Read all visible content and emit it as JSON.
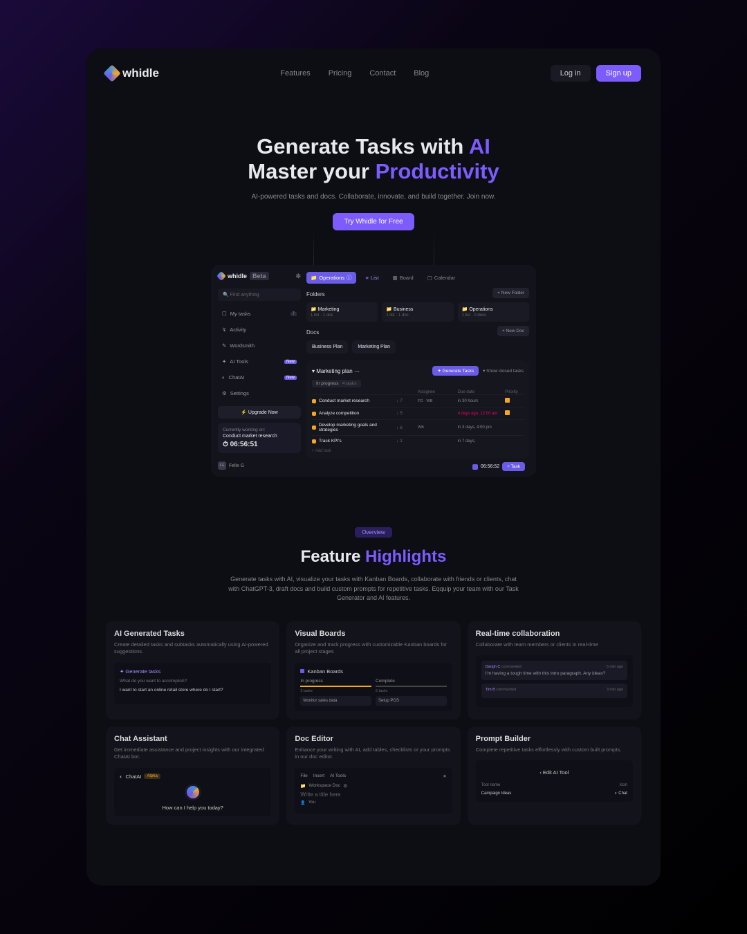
{
  "brand": "whidle",
  "nav": [
    "Features",
    "Pricing",
    "Contact",
    "Blog"
  ],
  "auth": {
    "login": "Log in",
    "signup": "Sign up"
  },
  "hero": {
    "line1a": "Generate Tasks with ",
    "line1b": "AI",
    "line2a": "Master your ",
    "line2b": "Productivity",
    "sub": "AI-powered tasks and docs. Collaborate, innovate, and build together. Join now.",
    "cta": "Try Whidle for Free"
  },
  "app": {
    "beta": "Beta",
    "search": "Find anything",
    "sidebar": [
      {
        "label": "My tasks",
        "ind": "7"
      },
      {
        "label": "Activity"
      },
      {
        "label": "Wordsmith"
      },
      {
        "label": "AI Tools",
        "tag": "New"
      },
      {
        "label": "ChatAI",
        "tag": "New"
      },
      {
        "label": "Settings"
      }
    ],
    "upgrade": "Upgrade Now",
    "working": {
      "lbl": "Currently working on:",
      "task": "Conduct market research",
      "time": "06:56:51"
    },
    "user": {
      "initials": "FG",
      "name": "Felix G"
    },
    "breadcrumb": "Operations",
    "views": [
      "List",
      "Board",
      "Calendar"
    ],
    "foldersLbl": "Folders",
    "newFolder": "+ New Folder",
    "folders": [
      {
        "name": "Marketing",
        "sub": "1 list · 1 doc"
      },
      {
        "name": "Business",
        "sub": "1 list · 1 doc"
      },
      {
        "name": "Operations",
        "sub": "1 list · 0 docs"
      }
    ],
    "docsLbl": "Docs",
    "newDoc": "+ New Doc",
    "docs": [
      "Business Plan",
      "Marketing Plan"
    ],
    "plan": {
      "title": "Marketing plan",
      "gen": "✦ Generate Tasks",
      "closed": "Show closed tasks",
      "status": "In progress",
      "count": "4 tasks",
      "cols": [
        "",
        "",
        "Assignee",
        "Due date",
        "Priority"
      ],
      "rows": [
        {
          "name": "Conduct market research",
          "ct": "↓ 7",
          "as": "FG · WB",
          "dt": "in 30 hours",
          "pr": true
        },
        {
          "name": "Analyze competition",
          "ct": "↓ 5",
          "as": "",
          "dt": "4 days ago, 12:00 am",
          "pr": true
        },
        {
          "name": "Develop marketing goals and strategies",
          "ct": "↓ 6",
          "as": "WB",
          "dt": "in 3 days, 4:00 pm",
          "pr": false
        },
        {
          "name": "Track KPI's",
          "ct": "↓ 1",
          "as": "",
          "dt": "in 7 days,",
          "pr": false
        }
      ],
      "addTask": "+ Add task",
      "timer": "06:56:52",
      "taskBtn": "+ Task"
    }
  },
  "features": {
    "chip": "Overview",
    "title1": "Feature ",
    "title2": "Highlights",
    "desc": "Generate tasks with AI, visualize your tasks with Kanban Boards, collaborate with friends or clients, chat with ChatGPT-3, draft docs and build custom prompts for repetitive tasks. Eqquip your team with our Task Generator and AI features.",
    "cards": [
      {
        "title": "AI Generated Tasks",
        "desc": "Create detailed tasks and subtasks automatically using AI-powered suggestions.",
        "demo": {
          "head": "✦ Generate tasks",
          "q": "What do you want to accomplish?",
          "a": "I want to start an online retail store where do I start?"
        }
      },
      {
        "title": "Visual Boards",
        "desc": "Organize and track progress with customizable Kanban boards for all project stages",
        "demo": {
          "head": "Kanban Boards",
          "col1": "In progress",
          "col1s": "3 tasks",
          "col2": "Complete",
          "col2s": "5 tasks",
          "item1": "Monitor sales data",
          "item2": "Setup POS"
        }
      },
      {
        "title": "Real-time collaboration",
        "desc": "Collaborate with team members or clients in real-time",
        "demo": {
          "c1n": "Darigh C",
          "c1a": "commented",
          "c1t": "5 min ago",
          "c1": "I'm having a tough time with this intro paragraph. Any ideas?",
          "c2n": "Tim B",
          "c2a": "commented",
          "c2t": "3 min ago"
        }
      },
      {
        "title": "Chat Assistant",
        "desc": "Get immediate assistance and project insights with our integrated ChatAI bot.",
        "demo": {
          "head": "ChatAI",
          "tag": "Alpha",
          "msg": "How can I help you today?"
        }
      },
      {
        "title": "Doc Editor",
        "desc": "Enhance your writing with AI, add tables, checklists or your prompts in our doc editor.",
        "demo": {
          "menu": [
            "File",
            "Insert",
            "AI Tools"
          ],
          "ws": "Workspace Doc",
          "title": "Write a title here",
          "you": "You"
        }
      },
      {
        "title": "Prompt Builder",
        "desc": "Complete repetitive tasks effortlessly with custom built prompts.",
        "demo": {
          "head": "Edit AI Tool",
          "l1": "Tool name",
          "l2": "Icon",
          "v1": "Campaign Ideas",
          "v2": "Chat"
        }
      }
    ]
  }
}
